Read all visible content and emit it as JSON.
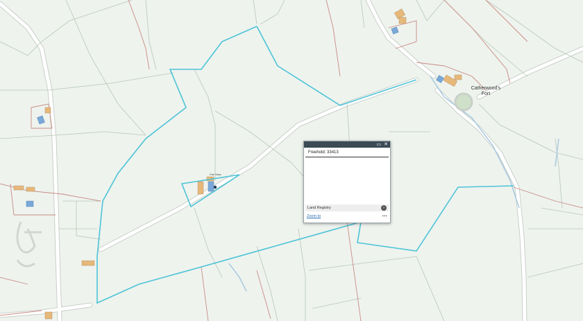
{
  "map": {
    "place_label_line1": "Catherwood's",
    "place_label_line2": "Fort",
    "house_label": "Fair View"
  },
  "popup": {
    "title": "Freehold: 33413",
    "layer_label": "Land Registry",
    "zoom_link": "Zoom to",
    "more_label": "•••",
    "minimize_icon": "window-icon",
    "close_icon": "close-icon"
  },
  "colors": {
    "background": "#eef3ee",
    "field_boundary": "#b8c6b8",
    "property_boundary": "#c98a80",
    "parcel_outline": "#4cc3d6",
    "road": "#ffffff",
    "building": "#e6b87a",
    "building_blue": "#7aa8d8"
  }
}
